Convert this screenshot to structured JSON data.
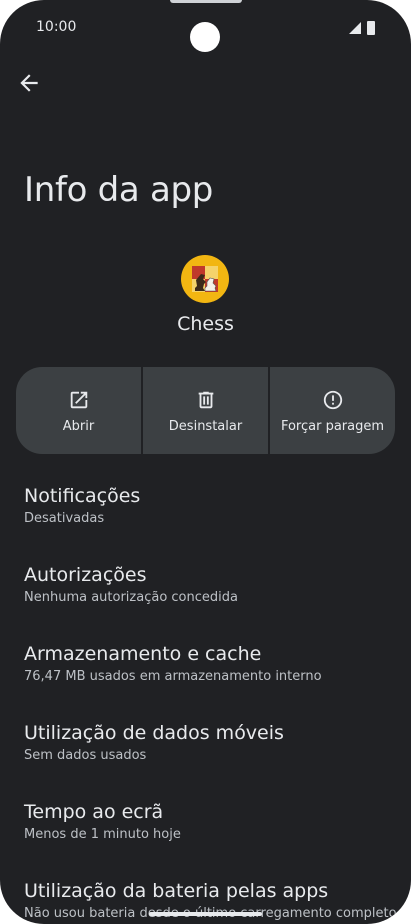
{
  "status_bar": {
    "time": "10:00"
  },
  "page": {
    "title": "Info da app"
  },
  "app": {
    "name": "Chess"
  },
  "actions": [
    {
      "label": "Abrir",
      "icon": "open-in-new-icon"
    },
    {
      "label": "Desinstalar",
      "icon": "trash-icon"
    },
    {
      "label": "Forçar paragem",
      "icon": "alert-circle-icon"
    }
  ],
  "settings": [
    {
      "title": "Notificações",
      "subtitle": "Desativadas"
    },
    {
      "title": "Autorizações",
      "subtitle": "Nenhuma autorização concedida"
    },
    {
      "title": "Armazenamento e cache",
      "subtitle": "76,47 MB usados em armazenamento interno"
    },
    {
      "title": "Utilização de dados móveis",
      "subtitle": "Sem dados usados"
    },
    {
      "title": "Tempo ao ecrã",
      "subtitle": "Menos de 1 minuto hoje"
    },
    {
      "title": "Utilização da bateria pelas apps",
      "subtitle": "Não usou bateria desde o último carregamento completo"
    }
  ],
  "colors": {
    "background": "#202124",
    "surface": "#3c4043",
    "text": "#e8eaed",
    "subtext": "#bdc1c6"
  }
}
